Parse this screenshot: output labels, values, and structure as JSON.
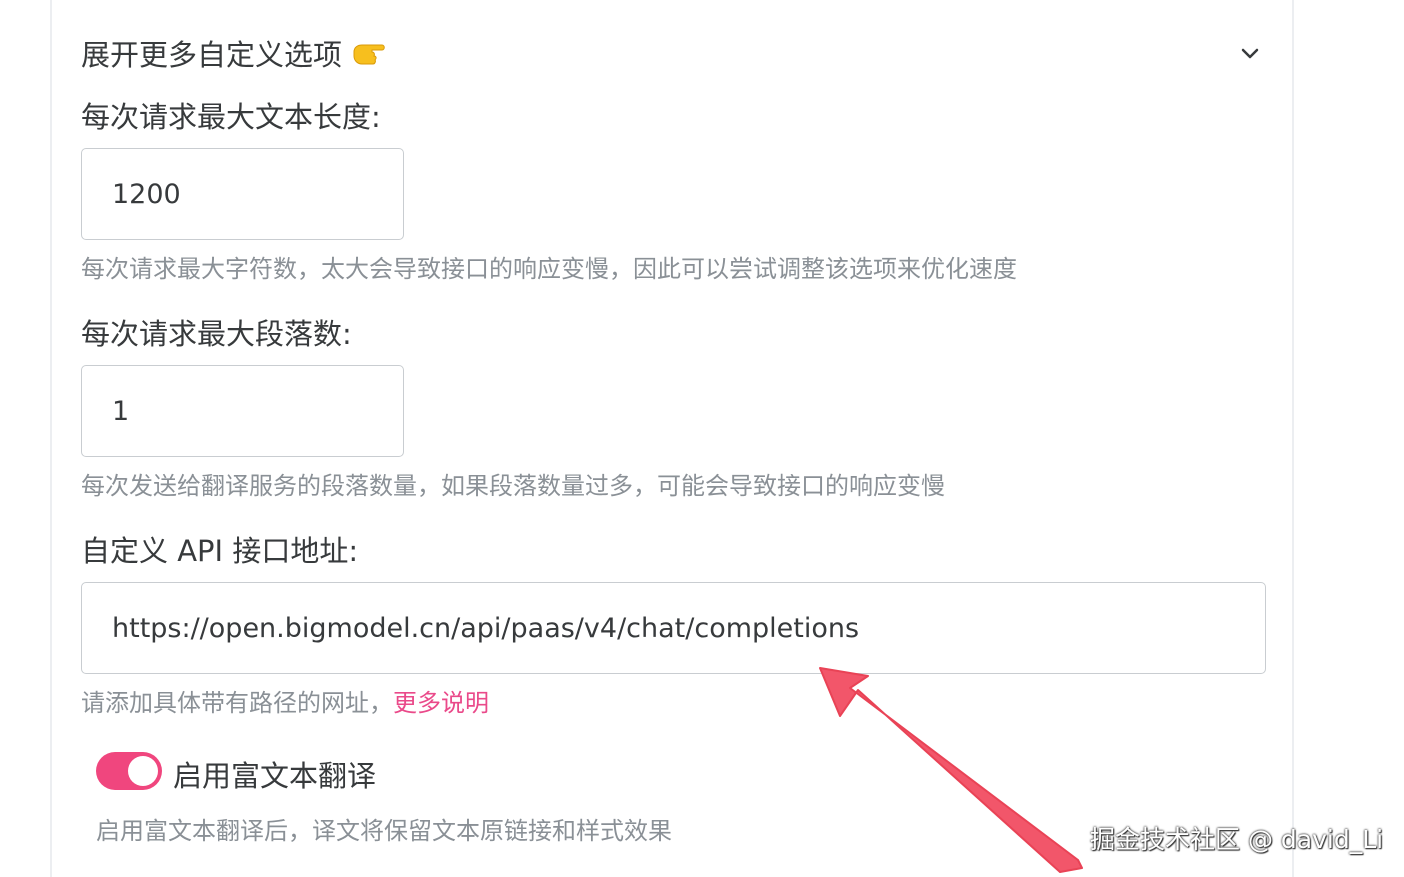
{
  "details": {
    "summary": "展开更多自定义选项",
    "summary_icon": "pointing-right-icon",
    "toggle_icon": "chevron-down-icon"
  },
  "max_text_length": {
    "label": "每次请求最大文本长度:",
    "value": "1200",
    "help": "每次请求最大字符数，太大会导致接口的响应变慢，因此可以尝试调整该选项来优化速度"
  },
  "max_paragraphs": {
    "label": "每次请求最大段落数:",
    "value": "1",
    "help": "每次发送给翻译服务的段落数量，如果段落数量过多，可能会导致接口的响应变慢"
  },
  "custom_api": {
    "label": "自定义 API 接口地址:",
    "value": "https://open.bigmodel.cn/api/paas/v4/chat/completions",
    "help": "请添加具体带有路径的网址，",
    "help_link": "更多说明"
  },
  "rich_text": {
    "label": "启用富文本翻译",
    "enabled": true,
    "help": "启用富文本翻译后，译文将保留文本原链接和样式效果"
  },
  "annotation": {
    "arrow_color": "#f2566a"
  },
  "watermark": "掘金技术社区 @ david_Li",
  "colors": {
    "accent": "#f0467e",
    "link": "#ea4a8a",
    "help_text": "#8a9096"
  }
}
